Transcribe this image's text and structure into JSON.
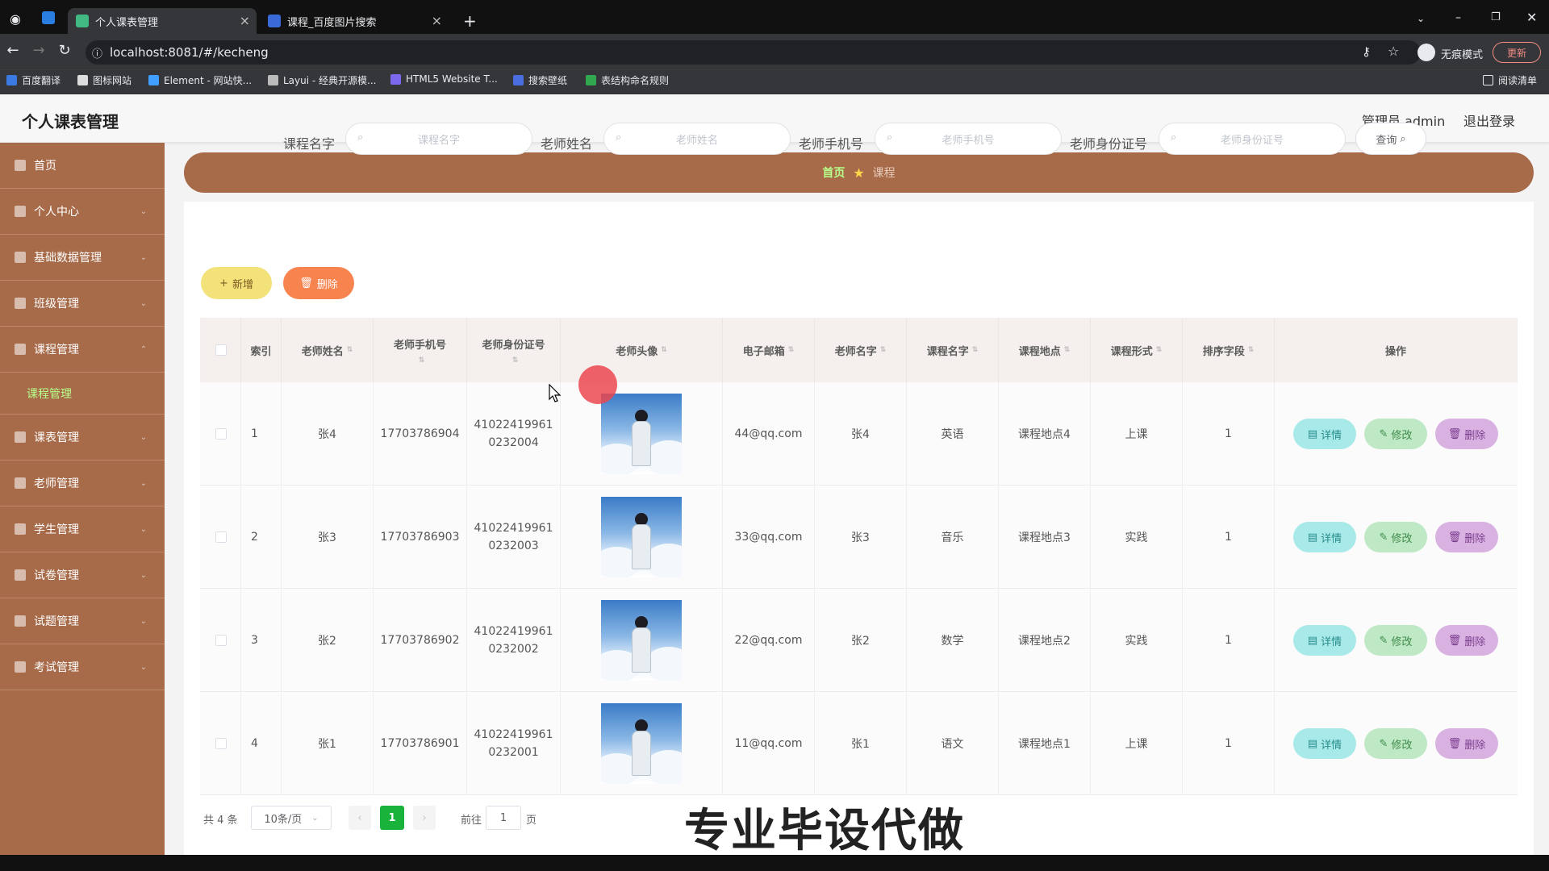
{
  "browser": {
    "tabs": [
      {
        "title": "个人课表管理",
        "active": true
      },
      {
        "title": "课程_百度图片搜索",
        "active": false
      }
    ],
    "new_tab": "+",
    "url": "localhost:8081/#/kecheng",
    "profile": "无痕模式",
    "update": "更新",
    "bookmarks": [
      "百度翻译",
      "图标网站",
      "Element - 网站快...",
      "Layui - 经典开源模...",
      "HTML5 Website T...",
      "搜索壁纸",
      "表结构命名规则"
    ],
    "reading_list": "阅读清单"
  },
  "app": {
    "title": "个人课表管理",
    "user": "管理员 admin",
    "logout": "退出登录"
  },
  "sidebar": {
    "items": [
      {
        "label": "首页",
        "icon": "home-icon"
      },
      {
        "label": "个人中心",
        "icon": "user-icon"
      },
      {
        "label": "基础数据管理",
        "icon": "monitor-icon"
      },
      {
        "label": "班级管理",
        "icon": "settings-icon"
      },
      {
        "label": "课程管理",
        "icon": "menu-icon"
      },
      {
        "label": "课表管理",
        "icon": "clock-icon"
      },
      {
        "label": "老师管理",
        "icon": "menu-icon"
      },
      {
        "label": "学生管理",
        "icon": "chart-icon"
      },
      {
        "label": "试卷管理",
        "icon": "settings-icon"
      },
      {
        "label": "试题管理",
        "icon": "bank-icon"
      },
      {
        "label": "考试管理",
        "icon": "grid-icon"
      }
    ],
    "sub_item": "课程管理"
  },
  "breadcrumb": {
    "home": "首页",
    "current": "课程"
  },
  "search": {
    "fields": [
      {
        "label": "课程名字",
        "placeholder": "课程名字"
      },
      {
        "label": "老师姓名",
        "placeholder": "老师姓名"
      },
      {
        "label": "老师手机号",
        "placeholder": "老师手机号"
      },
      {
        "label": "老师身份证号",
        "placeholder": "老师身份证号"
      }
    ],
    "query": "查询"
  },
  "actions": {
    "add": "新增",
    "delete": "删除"
  },
  "table": {
    "headers": [
      "索引",
      "老师姓名",
      "老师手机号",
      "老师身份证号",
      "老师头像",
      "电子邮箱",
      "老师名字",
      "课程名字",
      "课程地点",
      "课程形式",
      "排序字段",
      "操作"
    ],
    "rows": [
      {
        "index": "1",
        "teacher_name": "张4",
        "phone": "17703786904",
        "id_a": "41022419961",
        "id_b": "0232004",
        "email": "44@qq.com",
        "name": "张4",
        "course": "英语",
        "place": "课程地点4",
        "form": "上课",
        "sort": "1"
      },
      {
        "index": "2",
        "teacher_name": "张3",
        "phone": "17703786903",
        "id_a": "41022419961",
        "id_b": "0232003",
        "email": "33@qq.com",
        "name": "张3",
        "course": "音乐",
        "place": "课程地点3",
        "form": "实践",
        "sort": "1"
      },
      {
        "index": "3",
        "teacher_name": "张2",
        "phone": "17703786902",
        "id_a": "41022419961",
        "id_b": "0232002",
        "email": "22@qq.com",
        "name": "张2",
        "course": "数学",
        "place": "课程地点2",
        "form": "实践",
        "sort": "1"
      },
      {
        "index": "4",
        "teacher_name": "张1",
        "phone": "17703786901",
        "id_a": "41022419961",
        "id_b": "0232001",
        "email": "11@qq.com",
        "name": "张1",
        "course": "语文",
        "place": "课程地点1",
        "form": "上课",
        "sort": "1"
      }
    ],
    "row_actions": {
      "detail": "详情",
      "edit": "修改",
      "delete": "删除"
    }
  },
  "pagination": {
    "total": "共 4 条",
    "page_size": "10条/页",
    "current_page": "1",
    "goto_prefix": "前往",
    "goto_value": "1",
    "goto_suffix": "页"
  },
  "watermark": "专业毕设代做",
  "colors": {
    "sidebar": "#a86b4a",
    "active_sub": "#b6ff8a",
    "add_button": "#f3e27a",
    "delete_button": "#f7834f",
    "detail_button": "#a8eaea",
    "edit_button": "#bfe8c4",
    "row_delete_button": "#d9b2e2",
    "page_active": "#19b23a"
  }
}
